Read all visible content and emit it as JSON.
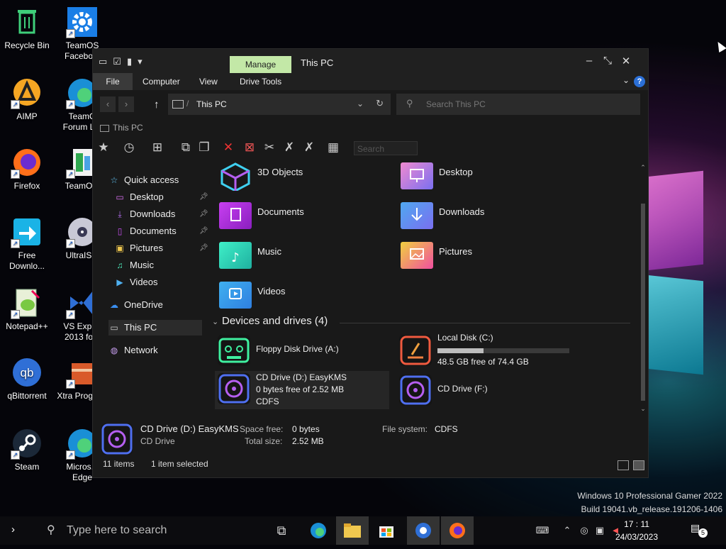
{
  "desktop": {
    "icons": [
      {
        "label": "Recycle Bin"
      },
      {
        "label": "TeamOS Facebo..."
      },
      {
        "label": "AIMP"
      },
      {
        "label": "TeamO Forum L..."
      },
      {
        "label": "Firefox"
      },
      {
        "label": "TeamO..."
      },
      {
        "label": "Free Downlo..."
      },
      {
        "label": "UltraIS..."
      },
      {
        "label": "Notepad++"
      },
      {
        "label": "VS Expr... 2013 fo..."
      },
      {
        "label": "qBittorrent"
      },
      {
        "label": "Xtra Progra..."
      },
      {
        "label": "Steam"
      },
      {
        "label": "Micros... Edge"
      }
    ]
  },
  "window": {
    "manage_tab": "Manage",
    "title": "This PC",
    "ribbon_tabs": [
      "File",
      "Computer",
      "View",
      "Drive Tools"
    ],
    "help": "?",
    "address": {
      "path": "This PC"
    },
    "search": {
      "placeholder": "Search This PC"
    },
    "breadcrumb": "This PC",
    "toolbar_search": "Search",
    "nav": {
      "quick_access": "Quick access",
      "items": [
        "Desktop",
        "Downloads",
        "Documents",
        "Pictures",
        "Music",
        "Videos"
      ],
      "onedrive": "OneDrive",
      "this_pc": "This PC",
      "network": "Network"
    },
    "folders": [
      "3D Objects",
      "Desktop",
      "Documents",
      "Downloads",
      "Music",
      "Pictures",
      "Videos"
    ],
    "devices_section": "Devices and drives (4)",
    "drives": [
      {
        "name": "Floppy Disk Drive (A:)"
      },
      {
        "name": "Local Disk (C:)",
        "free": "48.5 GB free of 74.4 GB",
        "used_fraction": 0.35
      },
      {
        "name": "CD Drive (D:) EasyKMS",
        "free": "0 bytes free of 2.52 MB",
        "fs": "CDFS"
      },
      {
        "name": "CD Drive (F:)"
      }
    ],
    "details": {
      "name": "CD Drive (D:) EasyKMS",
      "type": "CD Drive",
      "space_free_label": "Space free:",
      "space_free": "0 bytes",
      "total_size_label": "Total size:",
      "total_size": "2.52 MB",
      "fs_label": "File system:",
      "fs": "CDFS"
    },
    "status": {
      "items": "11 items",
      "selected": "1 item selected"
    }
  },
  "watermark": {
    "line1": "Windows 10 Professional Gamer 2022",
    "line2": "Build 19041.vb_release.191206-1406"
  },
  "taskbar": {
    "search_placeholder": "Type here to search",
    "time": "17 : 11",
    "date": "24/03/2023",
    "notifications": "5"
  }
}
